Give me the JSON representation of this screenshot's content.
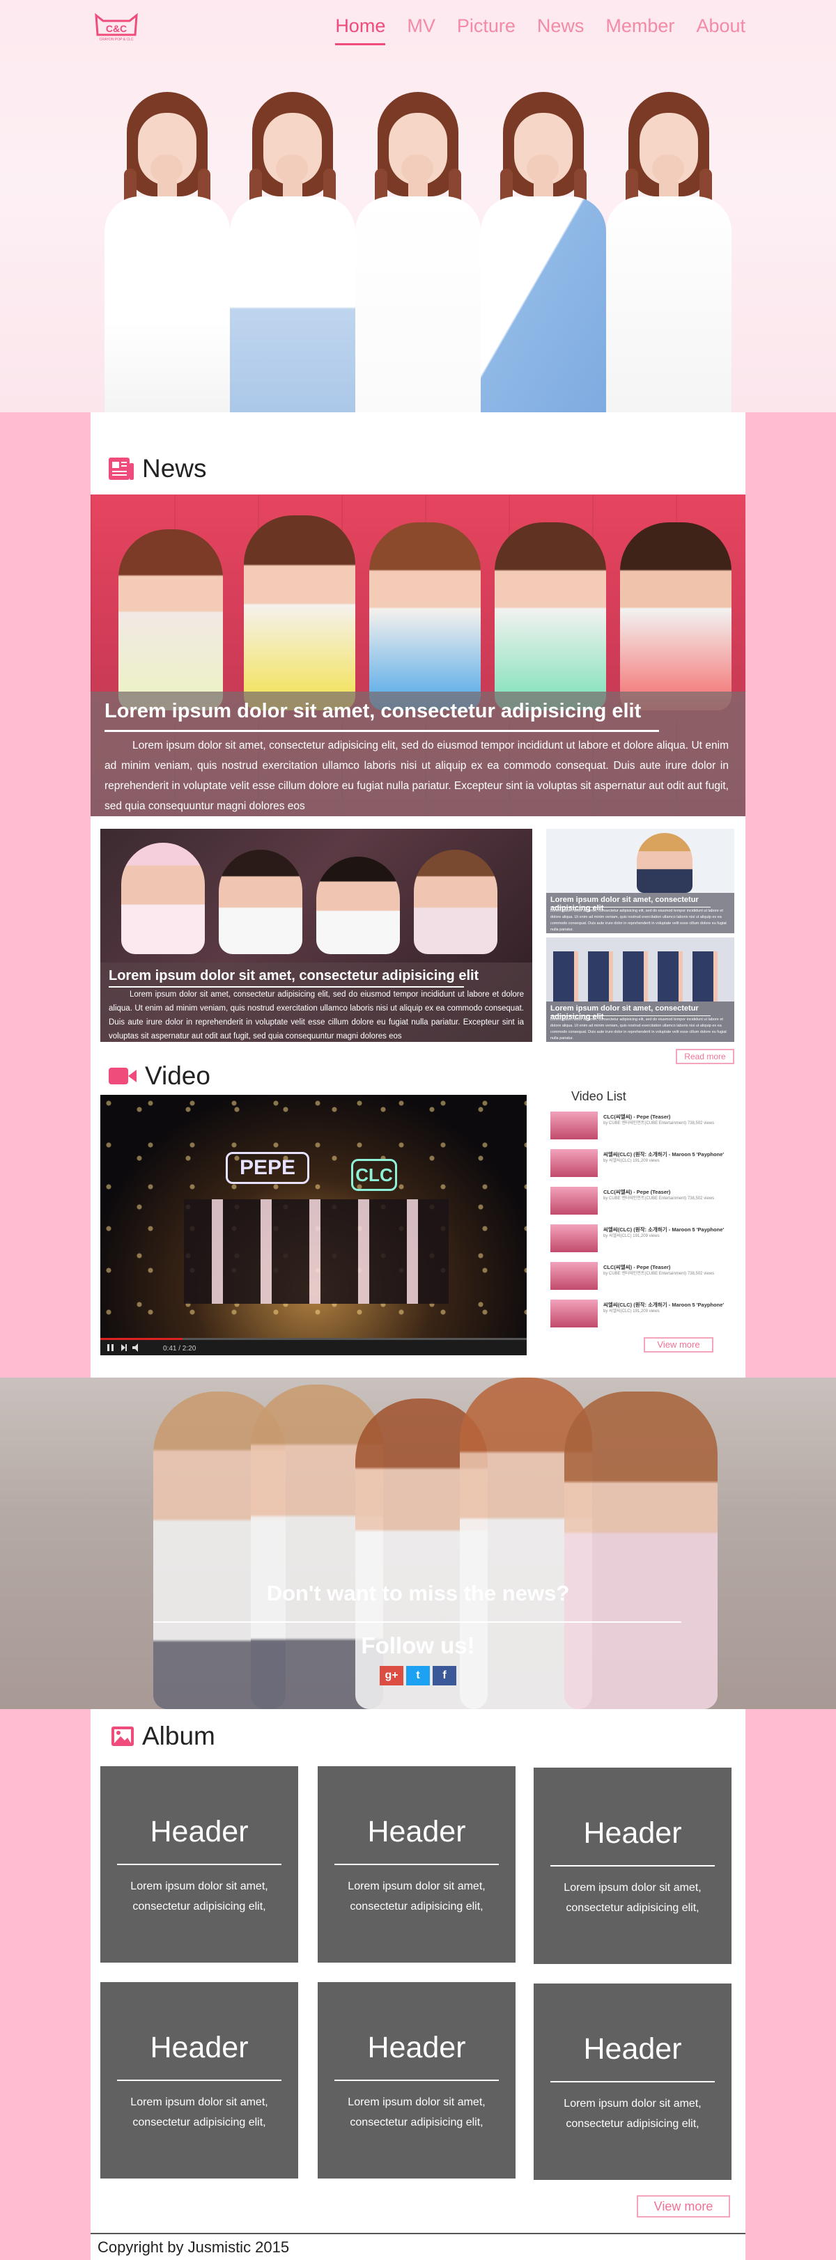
{
  "brand": {
    "logo_text": "C&C",
    "logo_subtext": "CRAYON POP & CLC"
  },
  "nav": {
    "items": [
      {
        "label": "Home",
        "active": true
      },
      {
        "label": "MV",
        "active": false
      },
      {
        "label": "Picture",
        "active": false
      },
      {
        "label": "News",
        "active": false
      },
      {
        "label": "Member",
        "active": false
      },
      {
        "label": "About",
        "active": false
      }
    ]
  },
  "news": {
    "title": "News",
    "icon": "newspaper-icon",
    "featured": {
      "title": "Lorem ipsum dolor sit amet, consectetur adipisicing elit",
      "text": "Lorem ipsum dolor sit amet, consectetur adipisicing elit, sed do eiusmod tempor incididunt ut labore et dolore aliqua. Ut enim ad minim veniam, quis nostrud exercitation ullamco laboris nisi ut aliquip ex ea commodo consequat. Duis aute irure dolor in reprehenderit in voluptate velit esse cillum dolore eu fugiat nulla pariatur. Excepteur sint ia voluptas sit aspernatur aut odit aut fugit, sed quia consequuntur magni dolores eos"
    },
    "secondary": {
      "title": "Lorem ipsum dolor sit amet, consectetur adipisicing elit",
      "text": "Lorem ipsum dolor sit amet, consectetur adipisicing elit, sed do eiusmod tempor incididunt ut labore et dolore aliqua. Ut enim ad minim veniam, quis nostrud exercitation ullamco laboris nisi ut aliquip ex ea commodo consequat. Duis aute irure dolor in reprehenderit in voluptate velit esse cillum dolore eu fugiat nulla pariatur. Excepteur sint ia voluptas sit aspernatur aut odit aut fugit, sed quia consequuntur magni dolores eos"
    },
    "small": [
      {
        "title": "Lorem ipsum dolor sit amet, consectetur adipisicing elit",
        "text": "Lorem ipsum dolor sit amet, consectetur adipisicing elit, sed do eiusmod tempor incididunt ut labore et dolore aliqua. Ut enim ad minim veniam, quis nostrud exercitation ullamco laboris nisi ut aliquip ex ea commodo consequat. Duis aute irure dolor in reprehenderit in voluptate velit esse cillum dolore eu fugiat nulla pariatur."
      },
      {
        "title": "Lorem ipsum dolor sit amet, consectetur adipisicing elit",
        "text": "Lorem ipsum dolor sit amet, consectetur adipisicing elit, sed do eiusmod tempor incididunt ut labore et dolore aliqua. Ut enim ad minim veniam, quis nostrud exercitation ullamco laboris nisi ut aliquip ex ea commodo consequat. Duis aute irure dolor in reprehenderit in voluptate velit esse cillum dolore eu fugiat nulla pariatur."
      }
    ],
    "read_more": "Read more"
  },
  "video": {
    "title": "Video",
    "icon": "video-camera-icon",
    "player_time": "0:41 / 2:20",
    "list_title": "Video List",
    "list": [
      {
        "title": "CLC(씨엘씨) - Pepe (Teaser)",
        "meta": "by CUBE 엔터테인먼트(CUBE Entertainment) 738,502 views"
      },
      {
        "title": "씨엘씨(CLC) (원작: 소개하기 - Maroon 5 'Payphone'",
        "meta": "by 씨엘씨(CLC) 191,209 views"
      },
      {
        "title": "CLC(씨엘씨) - Pepe (Teaser)",
        "meta": "by CUBE 엔터테인먼트(CUBE Entertainment) 738,502 views"
      },
      {
        "title": "씨엘씨(CLC) (원작: 소개하기 - Maroon 5 'Payphone'",
        "meta": "by 씨엘씨(CLC) 191,209 views"
      },
      {
        "title": "CLC(씨엘씨) - Pepe (Teaser)",
        "meta": "by CUBE 엔터테인먼트(CUBE Entertainment) 738,502 views"
      },
      {
        "title": "씨엘씨(CLC) (원작: 소개하기 - Maroon 5 'Payphone'",
        "meta": "by 씨엘씨(CLC) 191,209 views"
      }
    ],
    "view_more": "View more"
  },
  "follow": {
    "question": "Don't want to miss the news?",
    "cta": "Follow us!",
    "social": [
      {
        "icon": "google-plus-icon",
        "label": "g+",
        "color": "#dc4e41"
      },
      {
        "icon": "twitter-icon",
        "label": "t",
        "color": "#1da1f2"
      },
      {
        "icon": "facebook-icon",
        "label": "f",
        "color": "#3b5998"
      }
    ]
  },
  "album": {
    "title": "Album",
    "icon": "picture-icon",
    "cards": [
      {
        "header": "Header",
        "text": "Lorem ipsum dolor sit amet, consectetur adipisicing elit,"
      },
      {
        "header": "Header",
        "text": "Lorem ipsum dolor sit amet, consectetur adipisicing elit,"
      },
      {
        "header": "Header",
        "text": "Lorem ipsum dolor sit amet, consectetur adipisicing elit,"
      },
      {
        "header": "Header",
        "text": "Lorem ipsum dolor sit amet, consectetur adipisicing elit,"
      },
      {
        "header": "Header",
        "text": "Lorem ipsum dolor sit amet, consectetur adipisicing elit,"
      },
      {
        "header": "Header",
        "text": "Lorem ipsum dolor sit amet, consectetur adipisicing elit,"
      }
    ],
    "view_more": "View more"
  },
  "footer": {
    "copyright": "Copyright by Jusmistic 2015"
  },
  "colors": {
    "accent": "#ef4c7b",
    "page_background": "#ffbdd2",
    "card_background": "#616161"
  }
}
